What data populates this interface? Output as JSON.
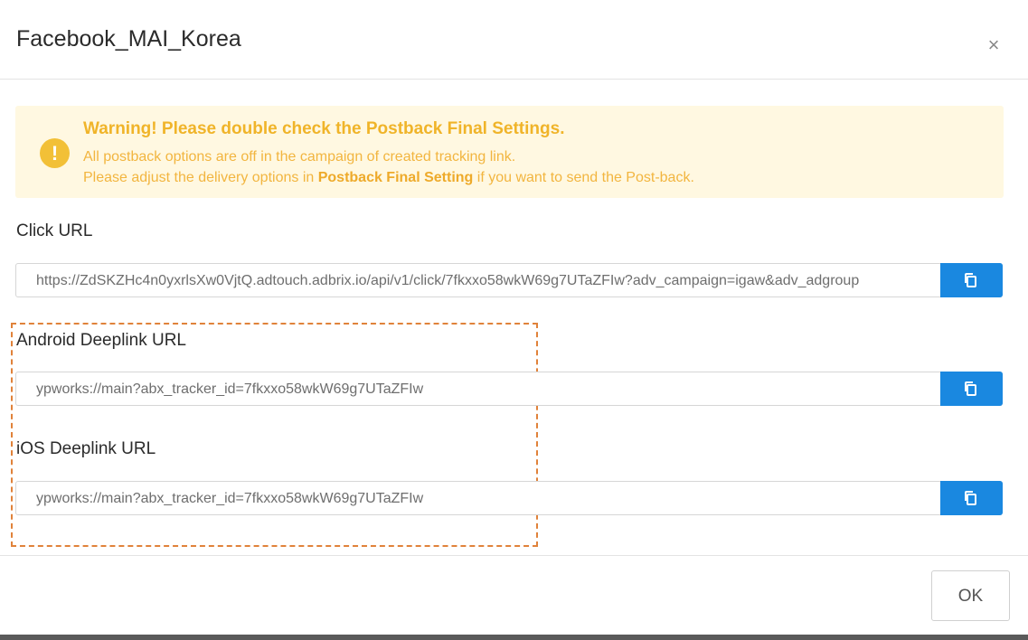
{
  "modal": {
    "title": "Facebook_MAI_Korea",
    "close_glyph": "×"
  },
  "warning": {
    "icon": "!",
    "title": "Warning! Please double check the Postback Final Settings.",
    "line1": "All postback options are off in the campaign of created tracking link.",
    "line2_pre": "Please adjust the delivery options in ",
    "line2_bold": "Postback Final Setting",
    "line2_post": " if you want to send the Post-back."
  },
  "fields": {
    "click": {
      "label": "Click URL",
      "value": "https://ZdSKZHc4n0yxrlsXw0VjtQ.adtouch.adbrix.io/api/v1/click/7fkxxo58wkW69g7UTaZFIw?adv_campaign=igaw&adv_adgroup"
    },
    "android": {
      "label": "Android Deeplink URL",
      "value": "ypworks://main?abx_tracker_id=7fkxxo58wkW69g7UTaZFIw"
    },
    "ios": {
      "label": "iOS Deeplink URL",
      "value": "ypworks://main?abx_tracker_id=7fkxxo58wkW69g7UTaZFIw"
    }
  },
  "footer": {
    "ok_label": "OK"
  },
  "colors": {
    "accent": "#1a88e0",
    "warning_bg": "#fff8e1",
    "warning_text": "#f0b429",
    "highlight_border": "#e0823a"
  },
  "icons": {
    "close": "close-icon",
    "warning": "exclamation-icon",
    "copy": "copy-icon"
  }
}
